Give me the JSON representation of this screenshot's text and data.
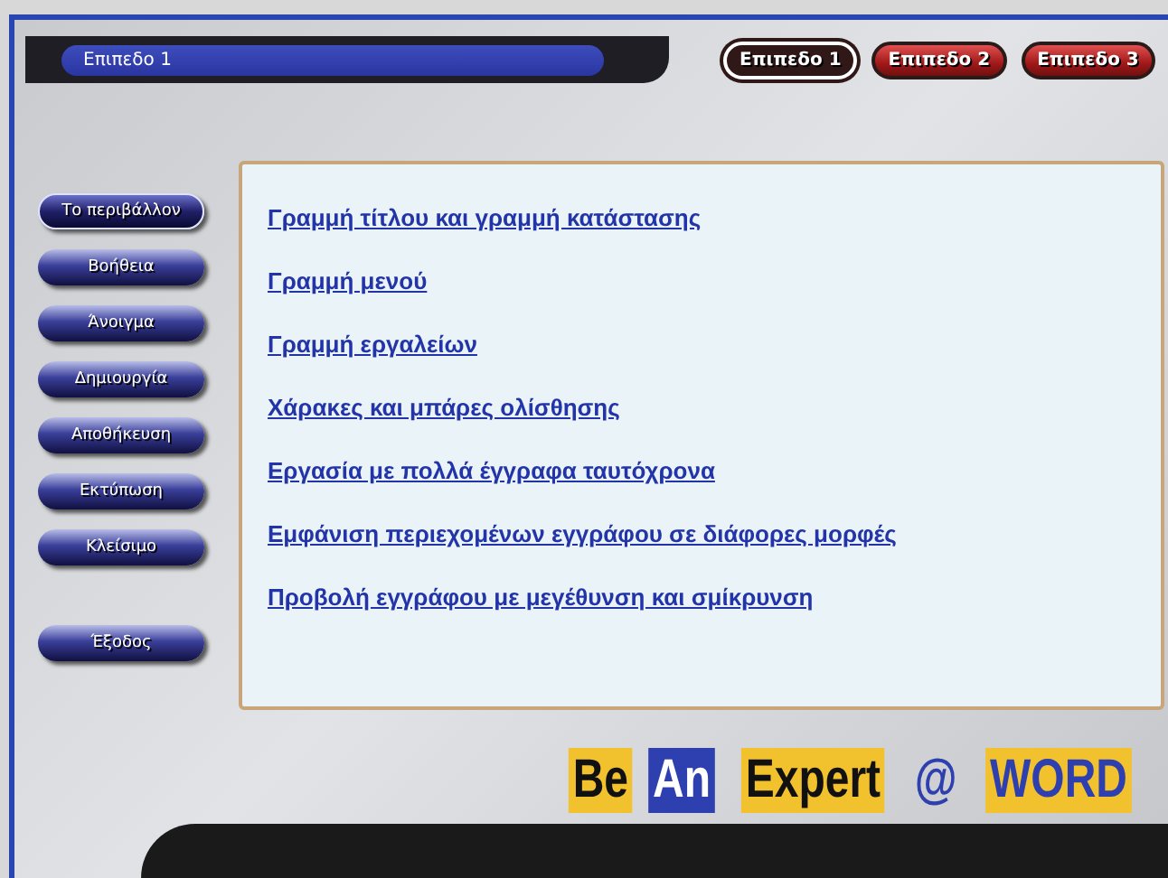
{
  "header": {
    "title": "Επιπεδο 1"
  },
  "levels": [
    {
      "label": "Επιπεδο 1",
      "selected": true
    },
    {
      "label": "Επιπεδο 2",
      "selected": false
    },
    {
      "label": "Επιπεδο 3",
      "selected": false
    }
  ],
  "sidebar": {
    "items": [
      {
        "label": "Το περιβάλλον",
        "selected": true
      },
      {
        "label": "Βοήθεια",
        "selected": false
      },
      {
        "label": "Άνοιγμα",
        "selected": false
      },
      {
        "label": "Δημιουργία",
        "selected": false
      },
      {
        "label": "Αποθήκευση",
        "selected": false
      },
      {
        "label": "Εκτύπωση",
        "selected": false
      },
      {
        "label": "Κλείσιμο",
        "selected": false
      }
    ],
    "exit": "Έξοδος"
  },
  "topics": [
    "Γραμμή τίτλου και γραμμή κατάστασης",
    "Γραμμή μενού",
    "Γραμμή εργαλείων",
    "Χάρακες και μπάρες ολίσθησης",
    "Εργασία με πολλά έγγραφα ταυτόχρονα",
    "Εμφάνιση περιεχομένων εγγράφου σε διάφορες μορφές",
    "Προβολή εγγράφου με μεγέθυνση και σμίκρυνση"
  ],
  "logo": [
    {
      "text": "Be",
      "kind": "plain"
    },
    {
      "text": "An",
      "kind": "inverse"
    },
    {
      "text": "Expert",
      "kind": "plain"
    },
    {
      "text": "@",
      "kind": "at"
    },
    {
      "text": "WORD",
      "kind": "accent"
    }
  ]
}
